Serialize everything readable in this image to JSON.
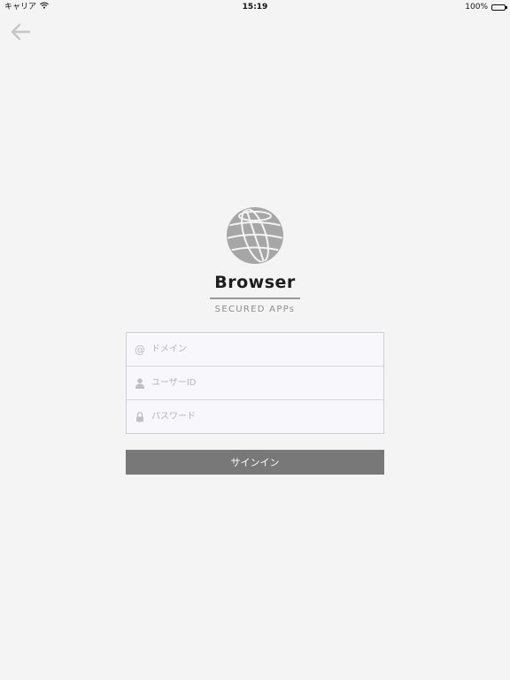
{
  "status_bar": {
    "carrier": "キャリア",
    "time": "15:19",
    "battery": "100%"
  },
  "icons": {
    "back": "arrow-left-icon",
    "wifi": "wifi-icon",
    "battery": "battery-icon",
    "logo": "globe-icon",
    "domain": "at-sign-icon",
    "user": "person-icon",
    "password": "lock-icon"
  },
  "brand": {
    "title": "Browser",
    "subtitle": "SECURED APPs"
  },
  "form": {
    "domain_placeholder": "ドメイン",
    "user_placeholder": "ユーザーID",
    "password_placeholder": "パスワード",
    "signin_label": "サインイン"
  },
  "colors": {
    "background": "#f4f4f4",
    "button": "#787878",
    "logo_gray": "#a6a6a6"
  }
}
